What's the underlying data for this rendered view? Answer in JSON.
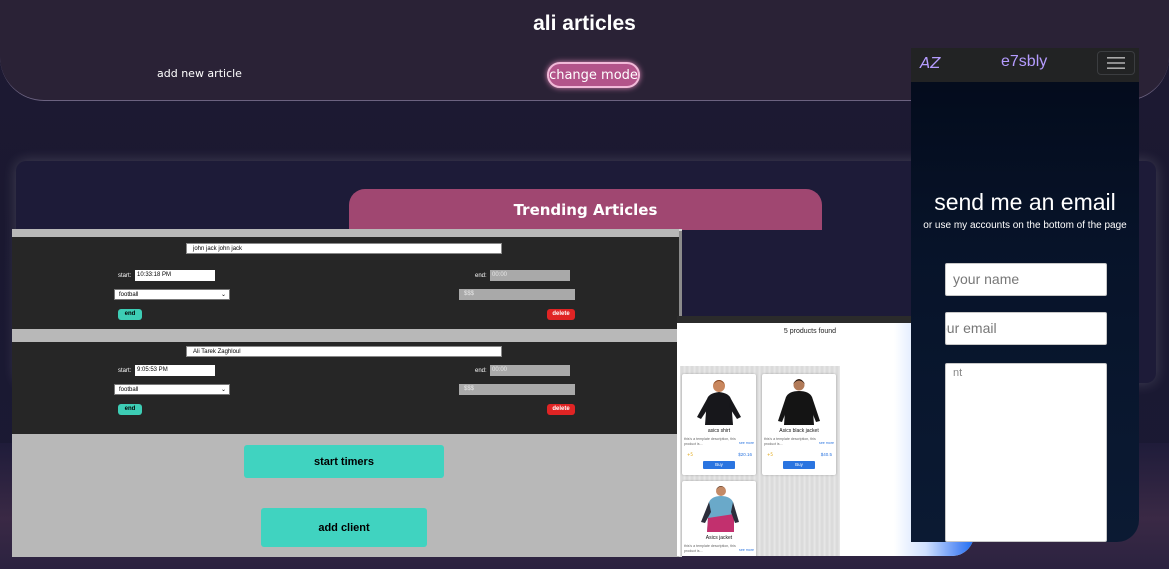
{
  "header": {
    "title": "ali articles",
    "add_article": "add new article",
    "change_mode": "change mode"
  },
  "trending": {
    "title": "Trending Articles"
  },
  "timers": {
    "clients": [
      {
        "name": "john jack john jack",
        "start_label": "start:",
        "start": "10:33:18 PM",
        "end_label": "end:",
        "end": "00:00",
        "game": "football",
        "price": "$$$",
        "end_btn": "end",
        "delete_btn": "delete"
      },
      {
        "name": "Ali Tarek Zaghloul",
        "start_label": "start:",
        "start": "9:05:53 PM",
        "end_label": "end:",
        "end": "00:00",
        "game": "football",
        "price": "$$$",
        "end_btn": "end",
        "delete_btn": "delete"
      }
    ],
    "start_timers": "start timers",
    "add_client": "add client"
  },
  "shop": {
    "found": "5 products found",
    "products": [
      {
        "title": "asics shirt",
        "desc": "this's a template description, this product is...",
        "more": "see more",
        "stars": "+5",
        "price": "$20.16",
        "buy": "Buy"
      },
      {
        "title": "Asics black jacket",
        "desc": "this's a template description, this product is...",
        "more": "see more",
        "stars": "+5",
        "price": "$40.5",
        "buy": "Buy"
      },
      {
        "title": "Asics jacket",
        "desc": "this's a template description, this product is...",
        "more": "see more"
      }
    ]
  },
  "contact": {
    "brand_short": "AZ",
    "brand_name": "e7sbly",
    "title": "send me an email",
    "subtitle": "or use my accounts on the bottom of the page",
    "name_placeholder": "your name",
    "email_visible": "our email",
    "message_visible": "nt"
  },
  "colors": {
    "accent_pink": "#b3548a",
    "tab_pink": "#a04771",
    "teal": "#40d3c0",
    "danger": "#e02424",
    "brand_purple": "#b59cff"
  }
}
